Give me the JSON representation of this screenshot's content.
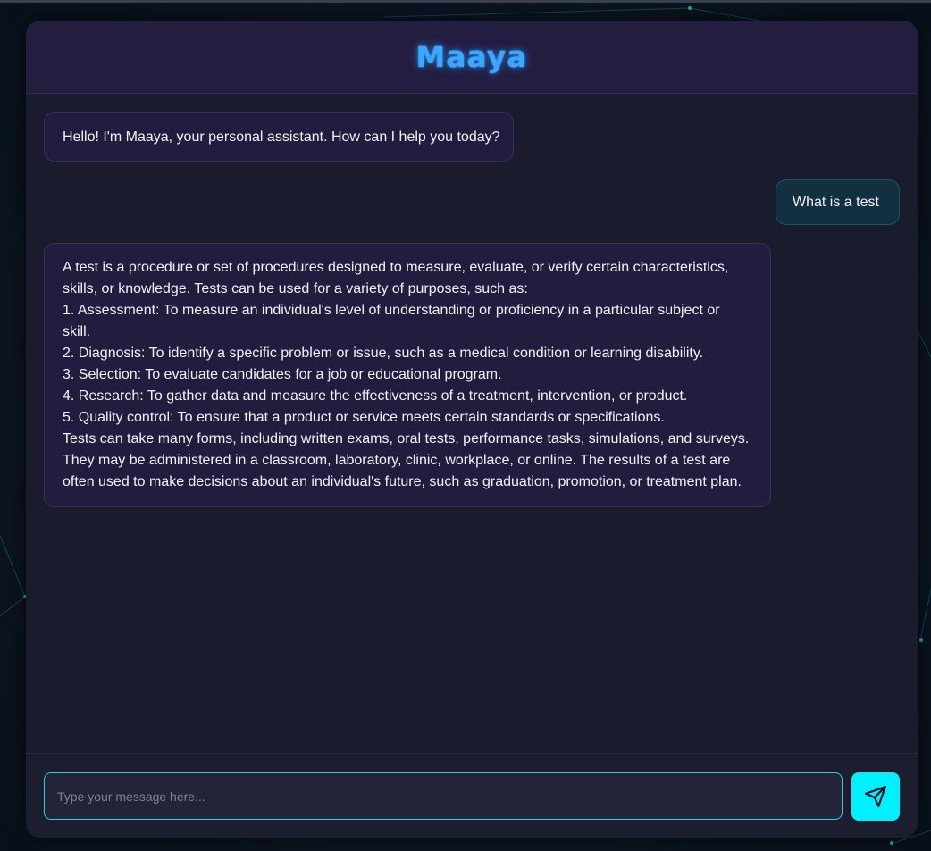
{
  "app": {
    "title": "Maaya"
  },
  "messages": [
    {
      "role": "assistant",
      "lines": [
        "Hello! I'm Maaya, your personal assistant. How can I help you today?"
      ]
    },
    {
      "role": "user",
      "lines": [
        "What is a test"
      ]
    },
    {
      "role": "assistant",
      "lines": [
        "A test is a procedure or set of procedures designed to measure, evaluate, or verify certain characteristics,",
        "skills, or knowledge. Tests can be used for a variety of purposes, such as:",
        "1. Assessment: To measure an individual's level of understanding or proficiency in a particular subject or",
        "skill.",
        "2. Diagnosis: To identify a specific problem or issue, such as a medical condition or learning disability.",
        "3. Selection: To evaluate candidates for a job or educational program.",
        "4. Research: To gather data and measure the effectiveness of a treatment, intervention, or product.",
        "5. Quality control: To ensure that a product or service meets certain standards or specifications.",
        "Tests can take many forms, including written exams, oral tests, performance tasks, simulations, and surveys.",
        "They may be administered in a classroom, laboratory, clinic, workplace, or online. The results of a test are",
        "often used to make decisions about an individual's future, such as graduation, promotion, or treatment plan."
      ]
    }
  ],
  "composer": {
    "value": "",
    "placeholder": "Type your message here...",
    "send_icon": "send-icon"
  },
  "colors": {
    "accent": "#00f0ff",
    "title": "#3aa8ff",
    "bot_bubble": "#241c3e",
    "user_bubble": "#12303f",
    "panel": "#1a1c2e",
    "header": "#231d40"
  }
}
